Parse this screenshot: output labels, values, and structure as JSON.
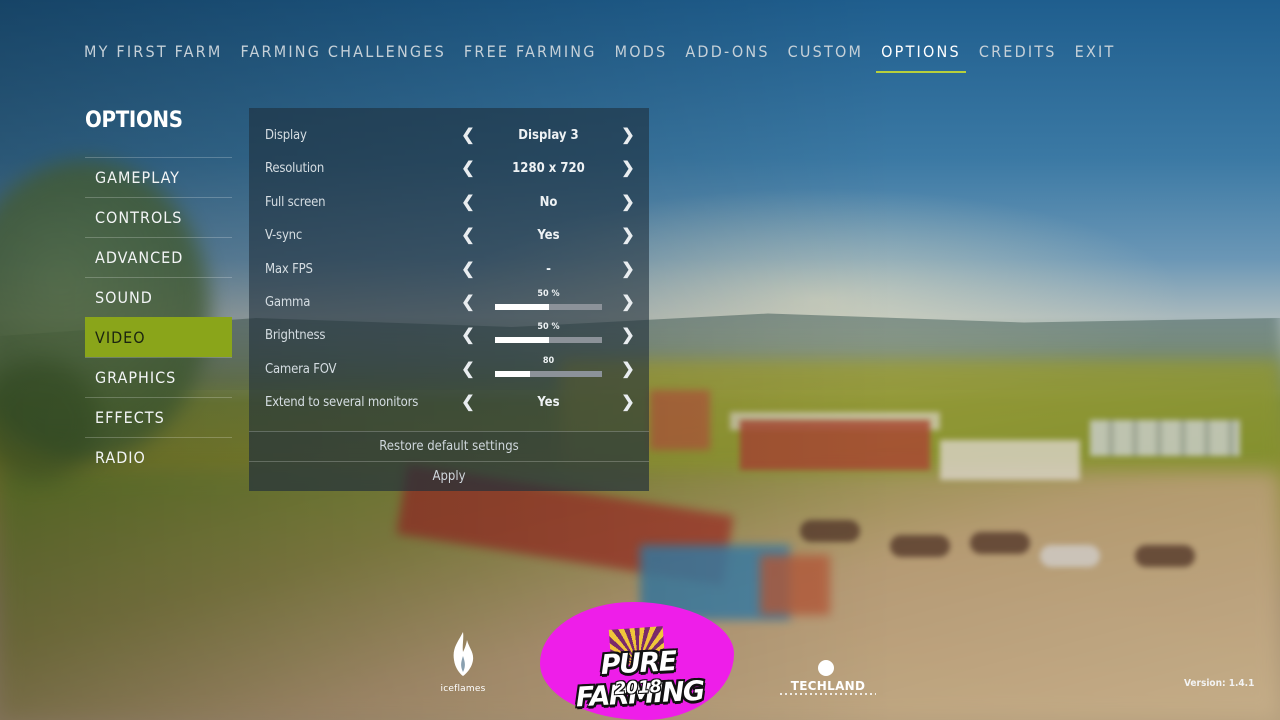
{
  "top_nav": [
    {
      "label": "MY FIRST FARM",
      "active": false
    },
    {
      "label": "FARMING CHALLENGES",
      "active": false
    },
    {
      "label": "FREE FARMING",
      "active": false
    },
    {
      "label": "MODS",
      "active": false
    },
    {
      "label": "ADD-ONS",
      "active": false
    },
    {
      "label": "CUSTOM",
      "active": false
    },
    {
      "label": "OPTIONS",
      "active": true
    },
    {
      "label": "CREDITS",
      "active": false
    },
    {
      "label": "EXIT",
      "active": false
    }
  ],
  "sidebar": {
    "title": "OPTIONS",
    "items": [
      {
        "label": "GAMEPLAY",
        "active": false
      },
      {
        "label": "CONTROLS",
        "active": false
      },
      {
        "label": "ADVANCED",
        "active": false
      },
      {
        "label": "SOUND",
        "active": false
      },
      {
        "label": "VIDEO",
        "active": true
      },
      {
        "label": "GRAPHICS",
        "active": false
      },
      {
        "label": "EFFECTS",
        "active": false
      },
      {
        "label": "RADIO",
        "active": false
      }
    ]
  },
  "settings": [
    {
      "label": "Display",
      "type": "select",
      "value": "Display 3"
    },
    {
      "label": "Resolution",
      "type": "select",
      "value": "1280 x 720"
    },
    {
      "label": "Full screen",
      "type": "select",
      "value": "No"
    },
    {
      "label": "V-sync",
      "type": "select",
      "value": "Yes"
    },
    {
      "label": "Max FPS",
      "type": "select",
      "value": "-"
    },
    {
      "label": "Gamma",
      "type": "slider",
      "value": "50 %",
      "fraction": 0.5
    },
    {
      "label": "Brightness",
      "type": "slider",
      "value": "50 %",
      "fraction": 0.5
    },
    {
      "label": "Camera FOV",
      "type": "slider",
      "value": "80",
      "fraction": 0.33
    },
    {
      "label": "Extend to several monitors",
      "type": "select",
      "value": "Yes"
    }
  ],
  "buttons": {
    "restore": "Restore default settings",
    "apply": "Apply"
  },
  "footer": {
    "icefl_logo_text": "iceflames",
    "game_logo_name": "PURE FARMING",
    "game_logo_year": "2018",
    "publisher_logo_text": "TECHLAND",
    "version": "Version: 1.4.1"
  },
  "colors": {
    "accent": "#8aa51a",
    "nav_underline": "#b7cf3c",
    "logo_blob": "#ee1ee9"
  }
}
